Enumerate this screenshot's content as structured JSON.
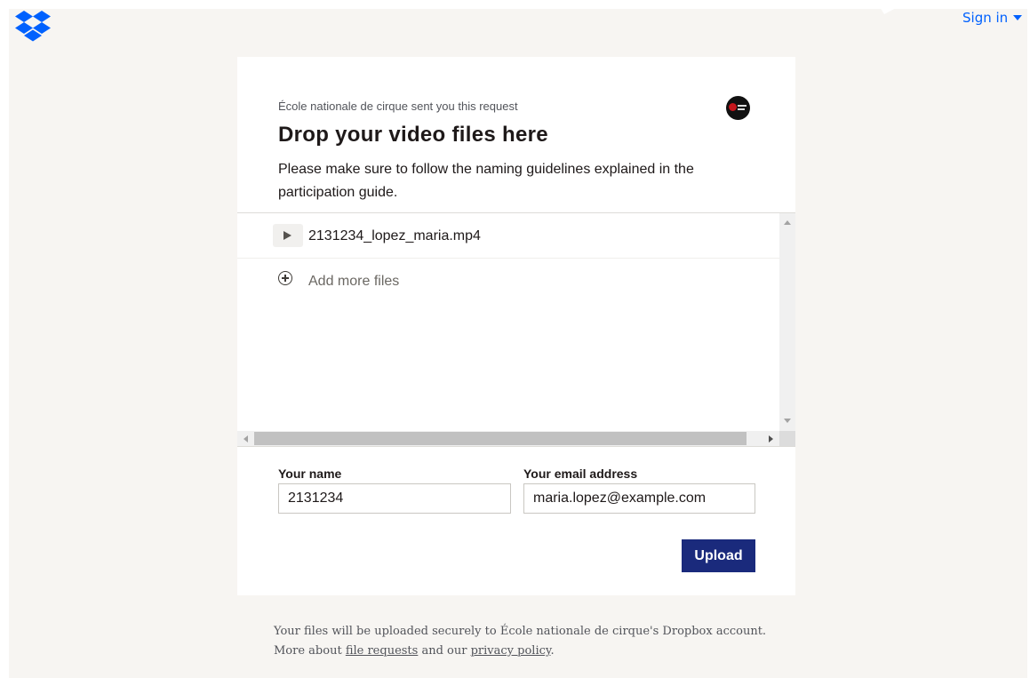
{
  "header": {
    "logo_icon": "dropbox-logo-icon",
    "brand_color": "#0061fe",
    "signin_label": "Sign in"
  },
  "request": {
    "sender_line": "École nationale de cirque sent you this request",
    "title": "Drop your video files here",
    "description": "Please make sure to follow the naming guidelines explained in the participation guide."
  },
  "files": {
    "items": [
      {
        "name": "2131234_lopez_maria.mp4",
        "icon": "play-icon"
      }
    ],
    "add_label": "Add more files",
    "add_icon": "add-circle-icon"
  },
  "form": {
    "name_label": "Your name",
    "name_value": "2131234",
    "email_label": "Your email address",
    "email_value": "maria.lopez@example.com",
    "upload_label": "Upload",
    "upload_color": "#1a2a7c"
  },
  "footer": {
    "line1": "Your files will be uploaded securely to École nationale de cirque's Dropbox account.",
    "more_about": "More about ",
    "file_requests_link": "file requests",
    "and_our": " and our ",
    "privacy_link": "privacy policy",
    "period": "."
  }
}
